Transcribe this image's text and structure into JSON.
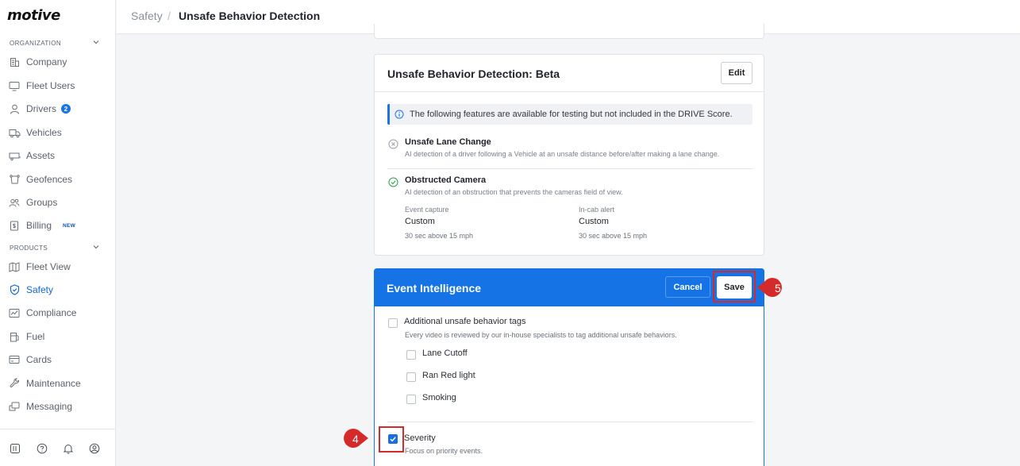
{
  "brand": {
    "logo": "motive"
  },
  "sidebar": {
    "org_section": "ORGANIZATION",
    "products_section": "PRODUCTS",
    "org_items": [
      {
        "label": "Company",
        "icon": "building-icon"
      },
      {
        "label": "Fleet Users",
        "icon": "monitor-icon"
      },
      {
        "label": "Drivers",
        "icon": "person-icon",
        "badge": "2"
      },
      {
        "label": "Vehicles",
        "icon": "truck-icon"
      },
      {
        "label": "Assets",
        "icon": "trailer-icon"
      },
      {
        "label": "Geofences",
        "icon": "geofence-icon"
      },
      {
        "label": "Groups",
        "icon": "group-icon"
      },
      {
        "label": "Billing",
        "icon": "billing-icon",
        "tag": "NEW"
      }
    ],
    "product_items": [
      {
        "label": "Fleet View",
        "icon": "map-icon"
      },
      {
        "label": "Safety",
        "icon": "shield-icon",
        "active": true
      },
      {
        "label": "Compliance",
        "icon": "compliance-icon"
      },
      {
        "label": "Fuel",
        "icon": "fuel-icon"
      },
      {
        "label": "Cards",
        "icon": "card-icon"
      },
      {
        "label": "Maintenance",
        "icon": "wrench-icon"
      },
      {
        "label": "Messaging",
        "icon": "message-icon"
      }
    ],
    "footer_icons": [
      "library-icon",
      "help-icon",
      "bell-icon",
      "account-icon"
    ]
  },
  "header": {
    "breadcrumb_parent": "Safety",
    "separator": "/",
    "breadcrumb_current": "Unsafe Behavior Detection"
  },
  "beta_card": {
    "title": "Unsafe Behavior Detection: Beta",
    "edit_label": "Edit",
    "info_text": "The following features are available for testing but not included in the DRIVE Score.",
    "features": [
      {
        "name": "Unsafe Lane Change",
        "desc": "AI detection of a driver following a Vehicle at an unsafe distance before/after making a lane change.",
        "status": "disabled"
      },
      {
        "name": "Obstructed Camera",
        "desc": "AI detection of an obstruction that prevents the cameras field of view.",
        "status": "enabled",
        "event_capture_label": "Event capture",
        "event_capture_value": "Custom",
        "event_capture_sub": "30 sec above 15 mph",
        "incab_label": "In-cab alert",
        "incab_value": "Custom",
        "incab_sub": "30 sec above 15 mph"
      }
    ]
  },
  "ei_card": {
    "title": "Event Intelligence",
    "cancel_label": "Cancel",
    "save_label": "Save",
    "tags_label": "Additional unsafe behavior tags",
    "tags_desc": "Every video is reviewed by our in-house specialists to tag additional unsafe behaviors.",
    "sub_tags": [
      "Lane Cutoff",
      "Ran Red light",
      "Smoking"
    ],
    "severity_label": "Severity",
    "severity_desc": "Focus on priority events.",
    "severity_checked": true
  },
  "annotations": {
    "step_save": "5",
    "step_severity": "4",
    "color": "#d42a2a"
  },
  "colors": {
    "accent": "#1573e6",
    "active_nav": "#1266d6"
  }
}
